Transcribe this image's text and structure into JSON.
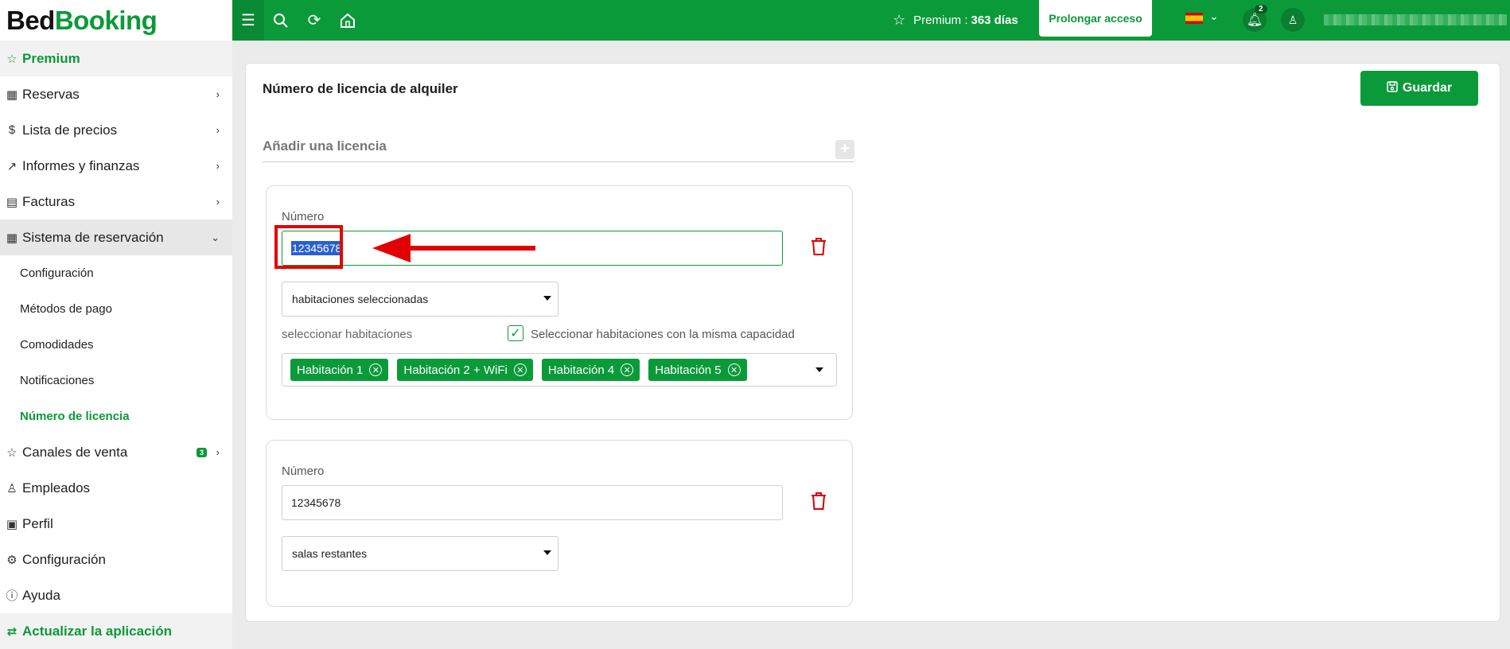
{
  "brand": {
    "part1": "Bed",
    "part2": "Booking"
  },
  "sidebar": {
    "items": [
      {
        "label": "Premium"
      },
      {
        "label": "Reservas"
      },
      {
        "label": "Lista de precios"
      },
      {
        "label": "Informes y finanzas"
      },
      {
        "label": "Facturas"
      },
      {
        "label": "Sistema de reservación"
      },
      {
        "label": "Configuración"
      },
      {
        "label": "Métodos de pago"
      },
      {
        "label": "Comodidades"
      },
      {
        "label": "Notificaciones"
      },
      {
        "label": "Número de licencia"
      },
      {
        "label": "Canales de venta",
        "badge": "3"
      },
      {
        "label": "Empleados"
      },
      {
        "label": "Perfil"
      },
      {
        "label": "Configuración"
      },
      {
        "label": "Ayuda"
      },
      {
        "label": "Actualizar la aplicación"
      }
    ]
  },
  "topbar": {
    "premium_label": "Premium :",
    "premium_days": "363 días",
    "prolong_label": "Prolongar acceso",
    "notif_count": "2"
  },
  "card": {
    "title": "Número de licencia de alquiler",
    "save_label": "Guardar",
    "add_label": "Añadir una licencia",
    "add_plus": "+"
  },
  "licenses": [
    {
      "number_label": "Número",
      "number_value": "12345678",
      "scope_value": "habitaciones seleccionadas",
      "rooms_label": "seleccionar habitaciones",
      "same_capacity_label": "Seleccionar habitaciones con la misma capacidad",
      "rooms": [
        "Habitación 1",
        "Habitación 2 + WiFi",
        "Habitación 4",
        "Habitación 5"
      ]
    },
    {
      "number_label": "Número",
      "number_value": "12345678",
      "scope_value": "salas restantes"
    }
  ],
  "colors": {
    "brand_green": "#0b9a39",
    "delete_red": "#d60000",
    "annotation_red": "#e30000"
  }
}
